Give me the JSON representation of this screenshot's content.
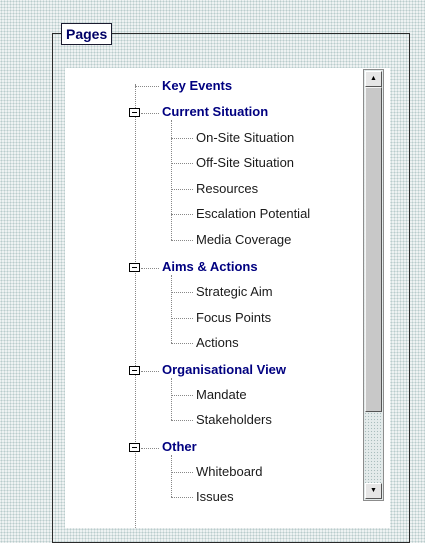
{
  "legend": "Pages",
  "tree": [
    {
      "label": "Key Events",
      "type": "cat",
      "toggle": false
    },
    {
      "label": "Current Situation",
      "type": "cat",
      "toggle": true
    },
    {
      "label": "On-Site Situation",
      "type": "leaf"
    },
    {
      "label": "Off-Site Situation",
      "type": "leaf"
    },
    {
      "label": "Resources",
      "type": "leaf"
    },
    {
      "label": "Escalation Potential",
      "type": "leaf"
    },
    {
      "label": "Media Coverage",
      "type": "leaf"
    },
    {
      "label": "Aims & Actions",
      "type": "cat",
      "toggle": true
    },
    {
      "label": "Strategic Aim",
      "type": "leaf"
    },
    {
      "label": "Focus Points",
      "type": "leaf"
    },
    {
      "label": "Actions",
      "type": "leaf"
    },
    {
      "label": "Organisational View",
      "type": "cat",
      "toggle": true
    },
    {
      "label": "Mandate",
      "type": "leaf"
    },
    {
      "label": "Stakeholders",
      "type": "leaf"
    },
    {
      "label": "Other",
      "type": "cat",
      "toggle": true
    },
    {
      "label": "Whiteboard",
      "type": "leaf"
    },
    {
      "label": "Issues",
      "type": "leaf"
    }
  ],
  "scrollbar": {
    "up_arrow": "▲",
    "down_arrow": "▼"
  },
  "icons": {
    "toggle": "collapse-minus-icon"
  }
}
